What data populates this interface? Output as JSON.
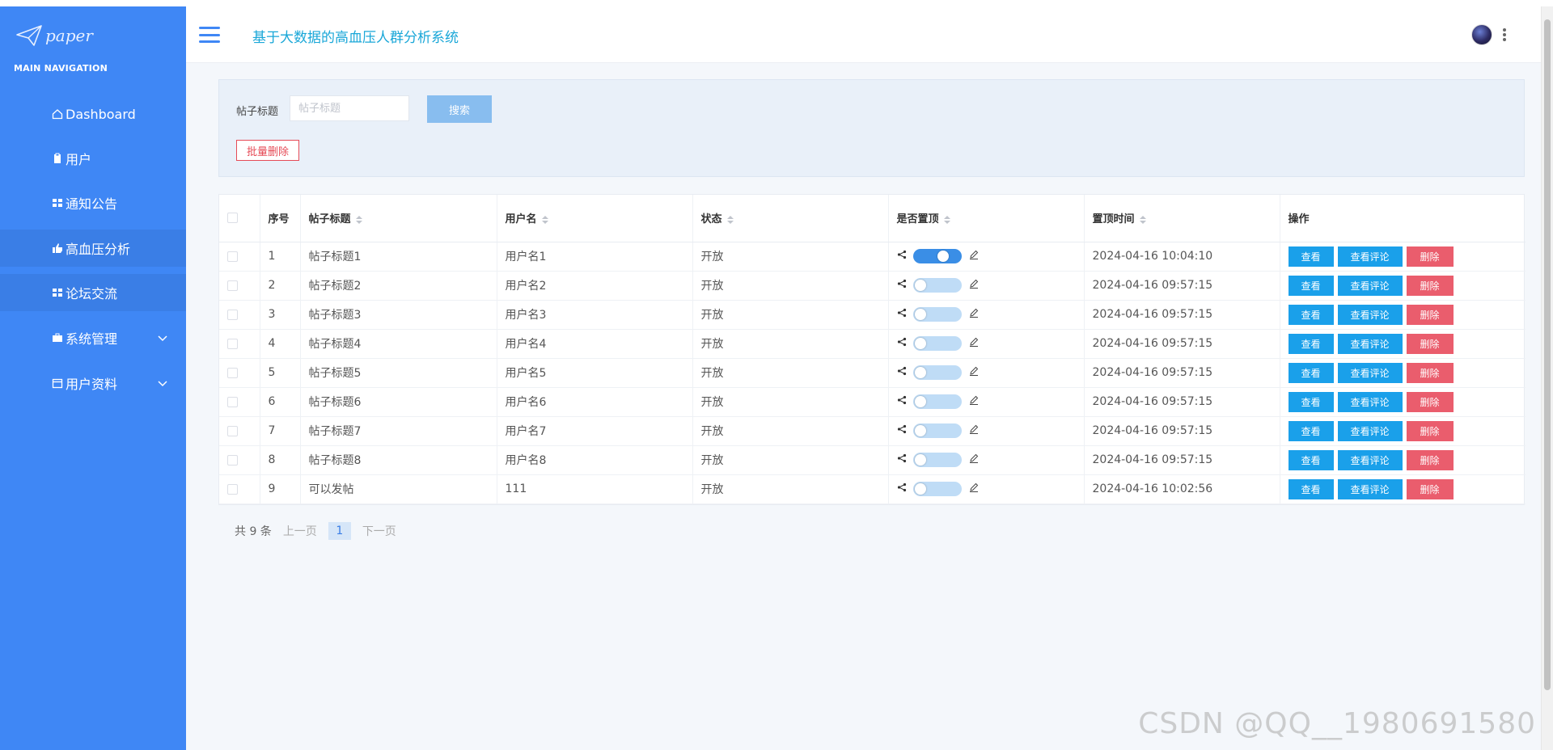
{
  "brand": {
    "logo_text": "paper"
  },
  "sidebar": {
    "heading": "MAIN NAVIGATION",
    "items": [
      {
        "label": "Dashboard",
        "icon": "home-icon"
      },
      {
        "label": "用户",
        "icon": "clipboard-icon"
      },
      {
        "label": "通知公告",
        "icon": "grid-icon"
      },
      {
        "label": "高血压分析",
        "icon": "thumbs-up-icon",
        "active": true
      },
      {
        "label": "论坛交流",
        "icon": "grid-icon",
        "active": true
      },
      {
        "label": "系统管理",
        "icon": "briefcase-icon",
        "expandable": true
      },
      {
        "label": "用户资料",
        "icon": "calendar-icon",
        "expandable": true
      }
    ]
  },
  "header": {
    "title": "基于大数据的高血压人群分析系统"
  },
  "search": {
    "label": "帖子标题",
    "placeholder": "帖子标题",
    "search_button": "搜索",
    "bulk_delete_button": "批量删除"
  },
  "table": {
    "columns": [
      "序号",
      "帖子标题",
      "用户名",
      "状态",
      "是否置顶",
      "置顶时间",
      "操作"
    ],
    "rows": [
      {
        "index": "1",
        "title": "帖子标题1",
        "user": "用户名1",
        "status": "开放",
        "pinned": true,
        "time": "2024-04-16 10:04:10"
      },
      {
        "index": "2",
        "title": "帖子标题2",
        "user": "用户名2",
        "status": "开放",
        "pinned": false,
        "time": "2024-04-16 09:57:15"
      },
      {
        "index": "3",
        "title": "帖子标题3",
        "user": "用户名3",
        "status": "开放",
        "pinned": false,
        "time": "2024-04-16 09:57:15"
      },
      {
        "index": "4",
        "title": "帖子标题4",
        "user": "用户名4",
        "status": "开放",
        "pinned": false,
        "time": "2024-04-16 09:57:15"
      },
      {
        "index": "5",
        "title": "帖子标题5",
        "user": "用户名5",
        "status": "开放",
        "pinned": false,
        "time": "2024-04-16 09:57:15"
      },
      {
        "index": "6",
        "title": "帖子标题6",
        "user": "用户名6",
        "status": "开放",
        "pinned": false,
        "time": "2024-04-16 09:57:15"
      },
      {
        "index": "7",
        "title": "帖子标题7",
        "user": "用户名7",
        "status": "开放",
        "pinned": false,
        "time": "2024-04-16 09:57:15"
      },
      {
        "index": "8",
        "title": "帖子标题8",
        "user": "用户名8",
        "status": "开放",
        "pinned": false,
        "time": "2024-04-16 09:57:15"
      },
      {
        "index": "9",
        "title": "可以发帖",
        "user": "111",
        "status": "开放",
        "pinned": false,
        "time": "2024-04-16 10:02:56"
      }
    ],
    "actions": {
      "view": "查看",
      "view_comments": "查看评论",
      "delete": "删除"
    }
  },
  "pagination": {
    "total": "共 9 条",
    "prev": "上一页",
    "current": "1",
    "next": "下一页"
  },
  "watermark": "CSDN @QQ__1980691580",
  "colors": {
    "sidebar": "#3f87f5",
    "accent": "#1aa0ea",
    "danger": "#ea5d6d",
    "title": "#1aa7d8"
  }
}
